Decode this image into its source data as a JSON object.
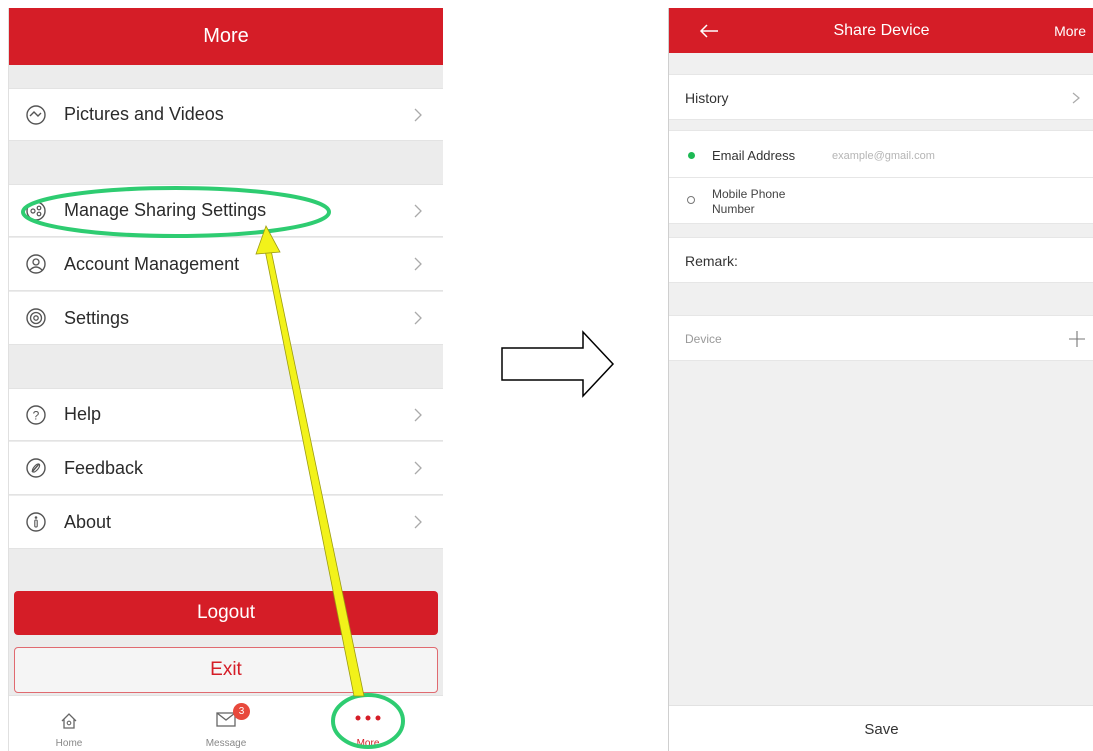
{
  "left": {
    "header_title": "More",
    "menu": [
      {
        "label": "Pictures and Videos",
        "icon": "pictures-icon"
      },
      {
        "label": "Manage Sharing Settings",
        "icon": "share-icon"
      },
      {
        "label": "Account Management",
        "icon": "account-icon"
      },
      {
        "label": "Settings",
        "icon": "settings-icon"
      },
      {
        "label": "Help",
        "icon": "help-icon"
      },
      {
        "label": "Feedback",
        "icon": "feedback-icon"
      },
      {
        "label": "About",
        "icon": "about-icon"
      }
    ],
    "logout_label": "Logout",
    "exit_label": "Exit",
    "tabs": [
      {
        "label": "Home",
        "icon": "home-icon"
      },
      {
        "label": "Message",
        "icon": "mail-icon",
        "badge": "3"
      },
      {
        "label": "More",
        "icon": "more-dots-icon"
      }
    ]
  },
  "right": {
    "header_title": "Share Device",
    "header_more": "More",
    "history_label": "History",
    "email_label": "Email Address",
    "email_placeholder": "example@gmail.com",
    "phone_label_line1": "Mobile Phone",
    "phone_label_line2": "Number",
    "remark_label": "Remark:",
    "device_label": "Device",
    "save_label": "Save"
  },
  "colors": {
    "brand_red": "#d51d27",
    "highlight_green": "#2ecc71",
    "pointer_yellow": "#f2f21a",
    "selected_radio": "#1db954"
  }
}
